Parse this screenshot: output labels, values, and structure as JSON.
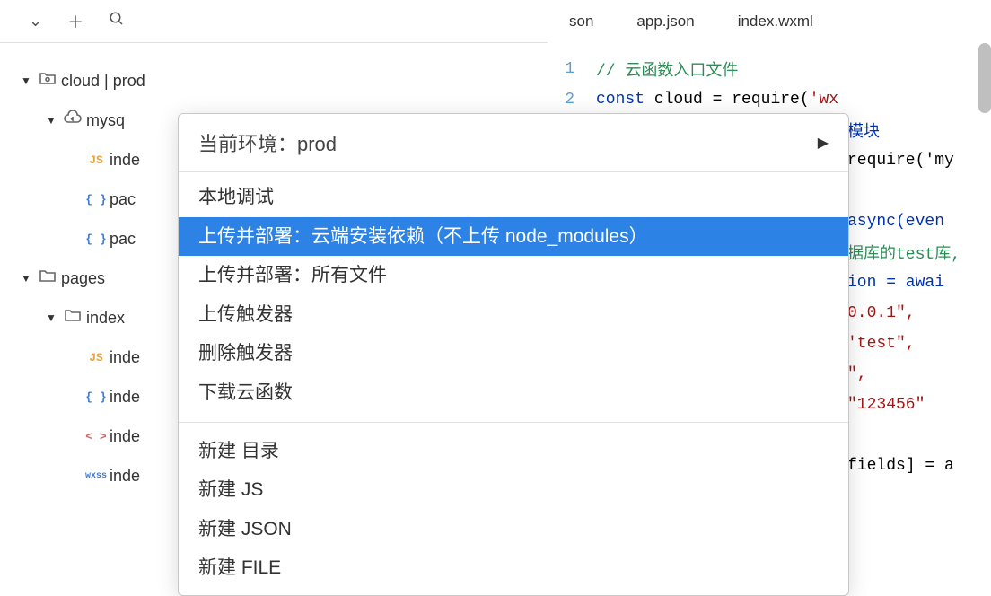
{
  "tabs": [
    "son",
    "app.json",
    "index.wxml"
  ],
  "tree": {
    "root": "cloud | prod",
    "mysql": "mysq",
    "files_mysql": [
      "inde",
      "pac",
      "pac"
    ],
    "pages": "pages",
    "index_folder": "index",
    "files_index": [
      "inde",
      "inde",
      "inde",
      "inde"
    ]
  },
  "context_menu": {
    "header": "当前环境：prod",
    "items1": [
      "本地调试",
      "上传并部署：云端安装依赖（不上传 node_modules）",
      "上传并部署：所有文件",
      "上传触发器",
      "删除触发器",
      "下载云函数"
    ],
    "items2": [
      "新建 目录",
      "新建 JS",
      "新建 JSON",
      "新建 FILE"
    ],
    "selected_index": 1
  },
  "code": {
    "line1_comment": "// 云函数入口文件",
    "line2": {
      "kw": "const",
      "rest": " cloud = require(",
      "str": "'wx"
    },
    "partial_lines": [
      "模块",
      "require('my",
      "",
      "async(even",
      "据库的test库,",
      "ion = awai",
      "0.0.1\",",
      "'test\",",
      "\",",
      "\"123456\"",
      "",
      "fields] = a"
    ]
  }
}
